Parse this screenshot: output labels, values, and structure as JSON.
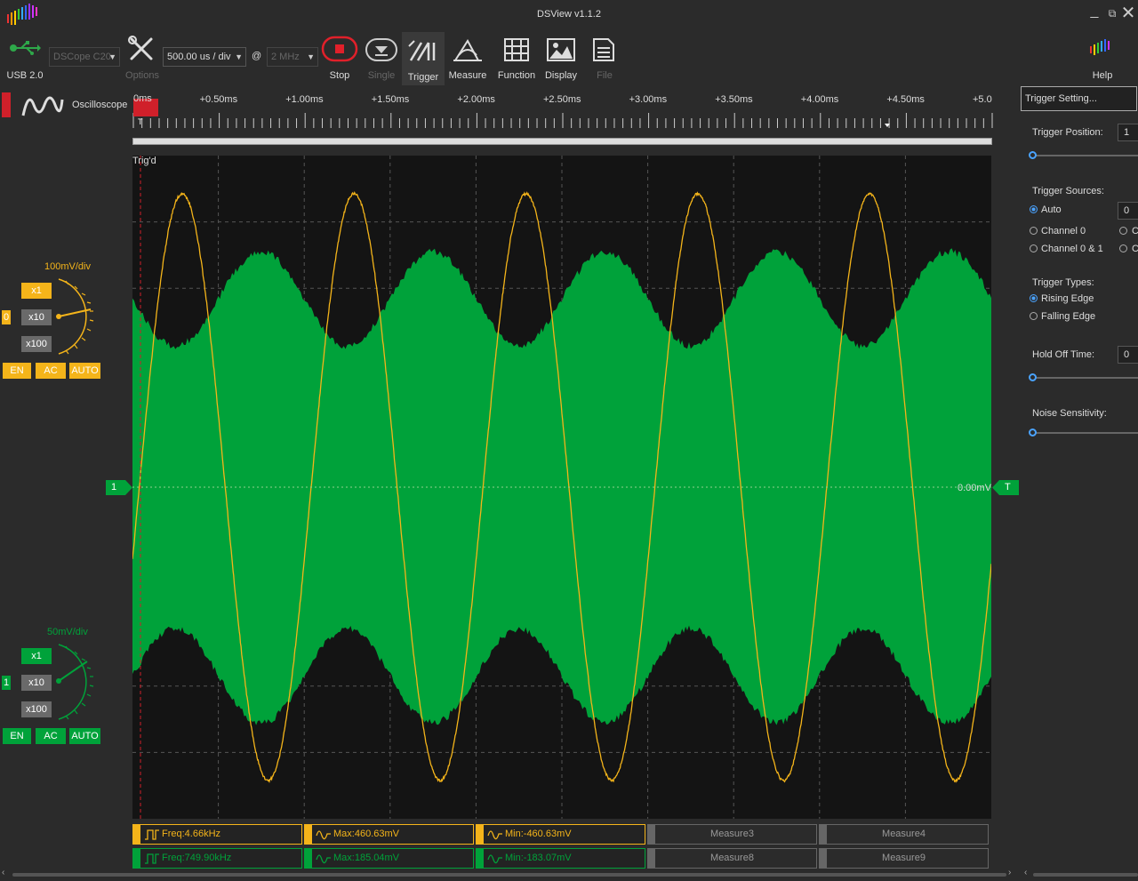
{
  "window": {
    "title": "DSView v1.1.2",
    "minimize_icon": "minimize-icon",
    "restore_icon": "restore-icon",
    "close_icon": "close-icon"
  },
  "toolbar": {
    "usb_label": "USB 2.0",
    "device_select": "DSCope C20",
    "options_label": "Options",
    "timebase_select": "500.00 us / div",
    "at_label": "@",
    "samplerate_select": "2 MHz",
    "stop_label": "Stop",
    "single_label": "Single",
    "trigger_label": "Trigger",
    "measure_label": "Measure",
    "function_label": "Function",
    "display_label": "Display",
    "file_label": "File",
    "help_label": "Help"
  },
  "mode": {
    "label": "Oscilloscope"
  },
  "ruler": {
    "ticks": [
      "0ms",
      "+0.50ms",
      "+1.00ms",
      "+1.50ms",
      "+2.00ms",
      "+2.50ms",
      "+3.00ms",
      "+3.50ms",
      "+4.00ms",
      "+4.50ms",
      "+5.0"
    ],
    "trigger_marker": "T"
  },
  "scope": {
    "status": "Trig'd",
    "ch1_marker": "1",
    "trigger_marker": "T",
    "level_readout": "0.00mV",
    "colors": {
      "ch0": "#f4b41a",
      "ch1": "#00a23a",
      "bg": "#141414",
      "grid": "#555555"
    }
  },
  "channels": [
    {
      "index": "0",
      "vdiv": "100mV/div",
      "x1": "x1",
      "x10": "x10",
      "x100": "x100",
      "en": "EN",
      "coupling": "AC",
      "auto": "AUTO",
      "color": "#f4b41a"
    },
    {
      "index": "1",
      "vdiv": "50mV/div",
      "x1": "x1",
      "x10": "x10",
      "x100": "x100",
      "en": "EN",
      "coupling": "AC",
      "auto": "AUTO",
      "color": "#00a23a"
    }
  ],
  "measurements": {
    "row0": [
      "Freq:4.66kHz",
      "Max:460.63mV",
      "Min:-460.63mV",
      "Measure3",
      "Measure4"
    ],
    "row1": [
      "Freq:749.90kHz",
      "Max:185.04mV",
      "Min:-183.07mV",
      "Measure8",
      "Measure9"
    ]
  },
  "trigger_panel": {
    "header": "Trigger Setting...",
    "position_label": "Trigger Position:",
    "position_value": "1",
    "sources_label": "Trigger Sources:",
    "source_auto": "Auto",
    "source_auto_value": "0",
    "source_ch0": "Channel 0",
    "source_ch01": "Channel 0 & 1",
    "source_c_a": "C",
    "source_c_b": "C",
    "types_label": "Trigger Types:",
    "type_rising": "Rising Edge",
    "type_falling": "Falling Edge",
    "holdoff_label": "Hold Off Time:",
    "holdoff_value": "0",
    "noise_label": "Noise Sensitivity:"
  }
}
